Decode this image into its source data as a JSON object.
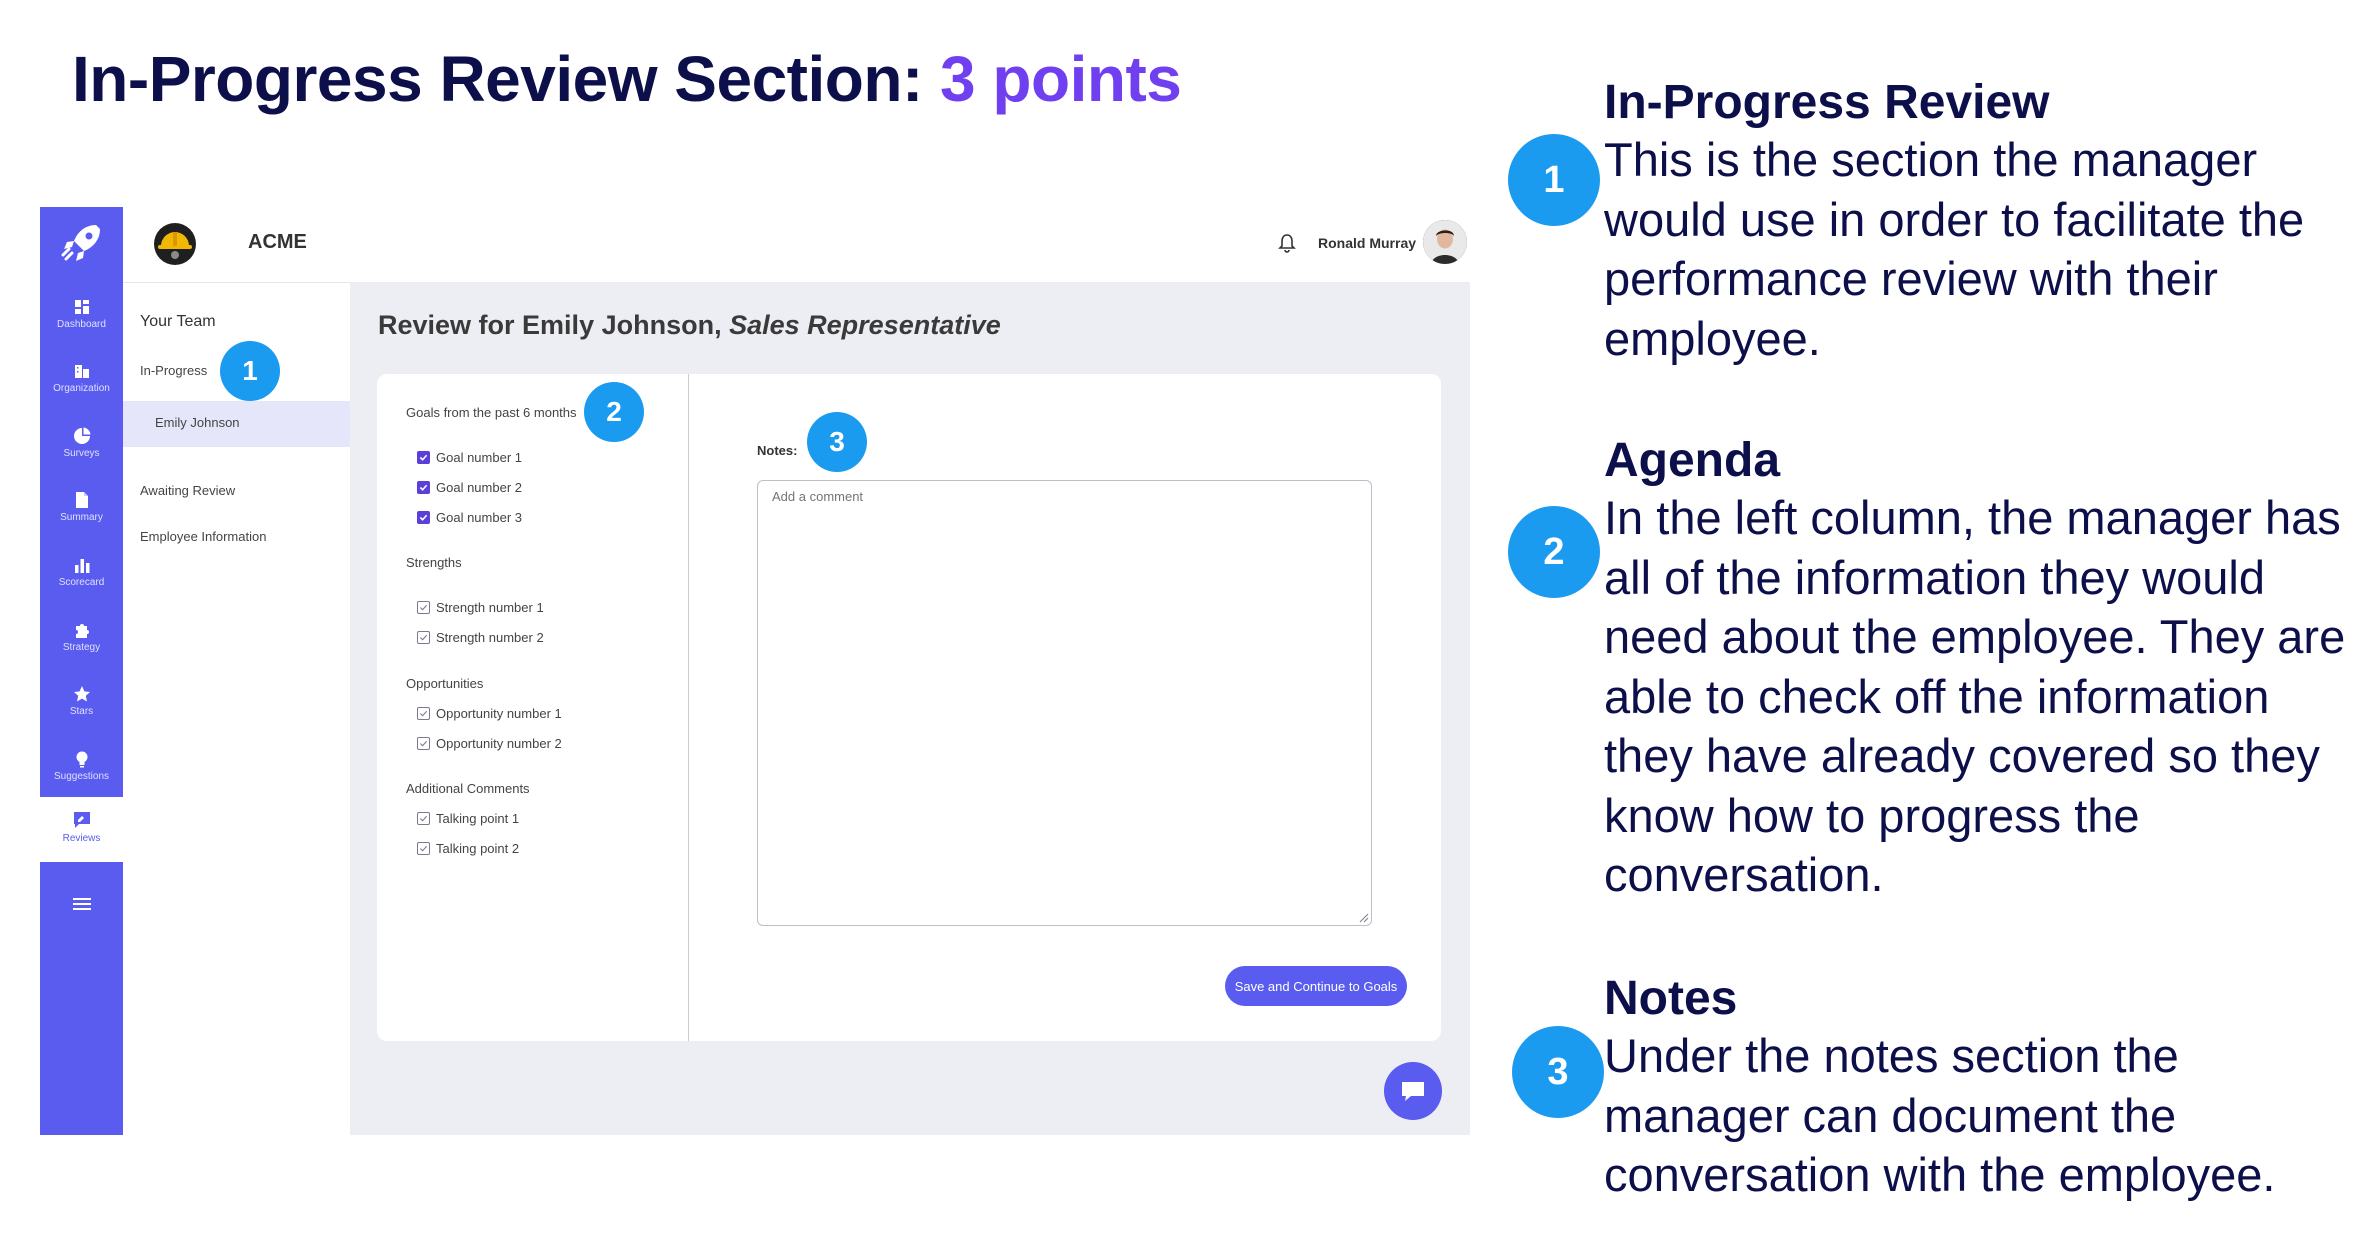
{
  "slide": {
    "title_main": "In-Progress Review Section: ",
    "title_accent": "3 points"
  },
  "app": {
    "rail": [
      {
        "label": "Dashboard",
        "icon": "dashboard-icon"
      },
      {
        "label": "Organization",
        "icon": "organization-icon"
      },
      {
        "label": "Surveys",
        "icon": "surveys-icon"
      },
      {
        "label": "Summary",
        "icon": "summary-icon"
      },
      {
        "label": "Scorecard",
        "icon": "scorecard-icon"
      },
      {
        "label": "Strategy",
        "icon": "strategy-icon"
      },
      {
        "label": "Stars",
        "icon": "star-icon"
      },
      {
        "label": "Suggestions",
        "icon": "lightbulb-icon"
      }
    ],
    "rail_active_label": "Reviews",
    "company": "ACME",
    "user": "Ronald Murray",
    "subnav": {
      "heading": "Your Team",
      "in_progress": "In-Progress",
      "selected_employee": "Emily Johnson",
      "awaiting": "Awaiting Review",
      "employee_info": "Employee Information"
    },
    "review": {
      "title_prefix": "Review for Emily Johnson, ",
      "title_role": "Sales Representative"
    },
    "agenda": {
      "goals_heading": "Goals from the past 6 months",
      "goals": [
        "Goal number 1",
        "Goal number 2",
        "Goal number 3"
      ],
      "strengths_heading": "Strengths",
      "strengths": [
        "Strength number 1",
        "Strength number 2"
      ],
      "opportunities_heading": "Opportunities",
      "opportunities": [
        "Opportunity number 1",
        "Opportunity number 2"
      ],
      "comments_heading": "Additional Comments",
      "comments": [
        "Talking point 1",
        "Talking point 2"
      ]
    },
    "notes": {
      "label": "Notes:",
      "placeholder": "Add a comment"
    },
    "save_label": "Save and Continue to Goals",
    "colors": {
      "primary": "#5a5cf0",
      "marker": "#1a9bf0",
      "checked": "#5a3fd8",
      "title": "#0d0f4a",
      "accent": "#6f3ff0"
    }
  },
  "markers": [
    "1",
    "2",
    "3"
  ],
  "points": [
    {
      "heading": "In-Progress Review",
      "text": "This is the section the manager would use in order to facilitate the performance review with their employee."
    },
    {
      "heading": "Agenda",
      "text": "In the left column, the manager has all of the information they would need about the employee. They are able to check off the information they have already covered so they know how to progress the conversation."
    },
    {
      "heading": "Notes",
      "text": "Under the notes section the manager can document the conversation with the employee."
    }
  ]
}
